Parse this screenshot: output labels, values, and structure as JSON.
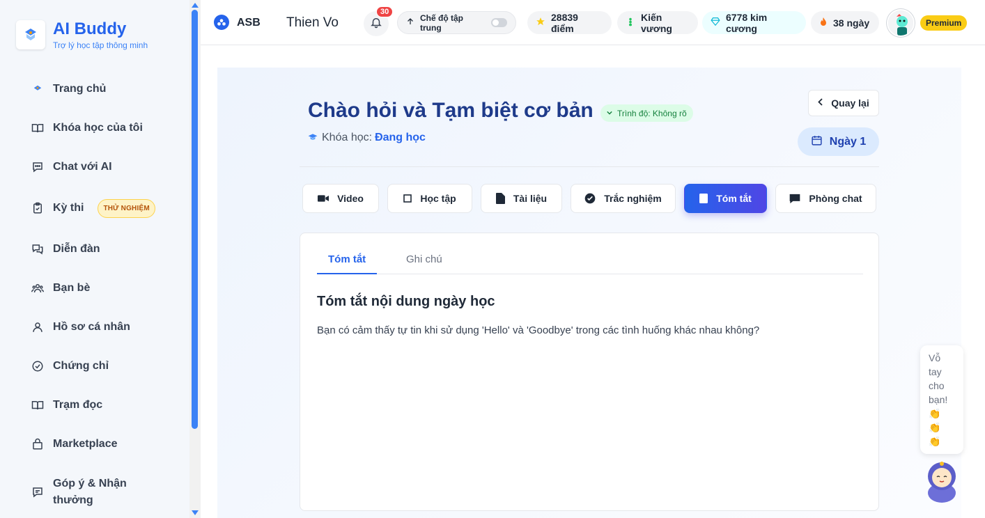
{
  "brand": {
    "title": "AI Buddy",
    "subtitle": "Trợ lý học tập thông minh"
  },
  "sidebar": {
    "items": [
      {
        "label": "Trang chủ",
        "icon": "home-icon"
      },
      {
        "label": "Khóa học của tôi",
        "icon": "book-open-icon"
      },
      {
        "label": "Chat với AI",
        "icon": "chat-icon"
      },
      {
        "label": "Kỳ thi",
        "icon": "clipboard-check-icon",
        "badge": "THỬ NGHIỆM"
      },
      {
        "label": "Diễn đàn",
        "icon": "forum-icon"
      },
      {
        "label": "Bạn bè",
        "icon": "users-icon"
      },
      {
        "label": "Hồ sơ cá nhân",
        "icon": "user-icon"
      },
      {
        "label": "Chứng chỉ",
        "icon": "check-circle-icon"
      },
      {
        "label": "Trạm đọc",
        "icon": "book-icon"
      },
      {
        "label": "Marketplace",
        "icon": "shopping-bag-icon"
      },
      {
        "label": "Góp ý & Nhận thưởng",
        "icon": "feedback-icon"
      }
    ]
  },
  "header": {
    "org": "ASB",
    "user_name": "Thien Vo",
    "notification_count": "30",
    "focus_mode_label": "Chế độ tập trung",
    "points": "28839 điểm",
    "rank": "Kiến vương",
    "gems": "6778 kim cương",
    "streak": "38 ngày",
    "plan": "Premium"
  },
  "lesson": {
    "title": "Chào hỏi và Tạm biệt cơ bản",
    "level": "Trình độ: Không rõ",
    "course_label": "Khóa học:",
    "course_status": "Đang học",
    "back_label": "Quay lại",
    "day_label": "Ngày 1"
  },
  "tabs": [
    {
      "label": "Video",
      "icon": "video-icon"
    },
    {
      "label": "Học tập",
      "icon": "square-icon"
    },
    {
      "label": "Tài liệu",
      "icon": "document-icon"
    },
    {
      "label": "Trắc nghiệm",
      "icon": "check-circle-filled-icon"
    },
    {
      "label": "Tóm tắt",
      "icon": "summary-icon",
      "active": true
    },
    {
      "label": "Phòng chat",
      "icon": "message-icon"
    }
  ],
  "summary": {
    "subtabs": [
      "Tóm tắt",
      "Ghi chú"
    ],
    "active_subtab": "Tóm tắt",
    "heading": "Tóm tắt nội dung ngày học",
    "text": "Bạn có cảm thấy tự tin khi sử dụng 'Hello' và 'Goodbye' trong các tình huống khác nhau không?"
  },
  "clap": {
    "text": "Vỗ tay cho bạn!",
    "emoji": "👏"
  },
  "colors": {
    "primary": "#2563eb",
    "accent": "#4f46e5",
    "sidebar_bg": "#f4f7fb",
    "premium": "#facc15"
  }
}
